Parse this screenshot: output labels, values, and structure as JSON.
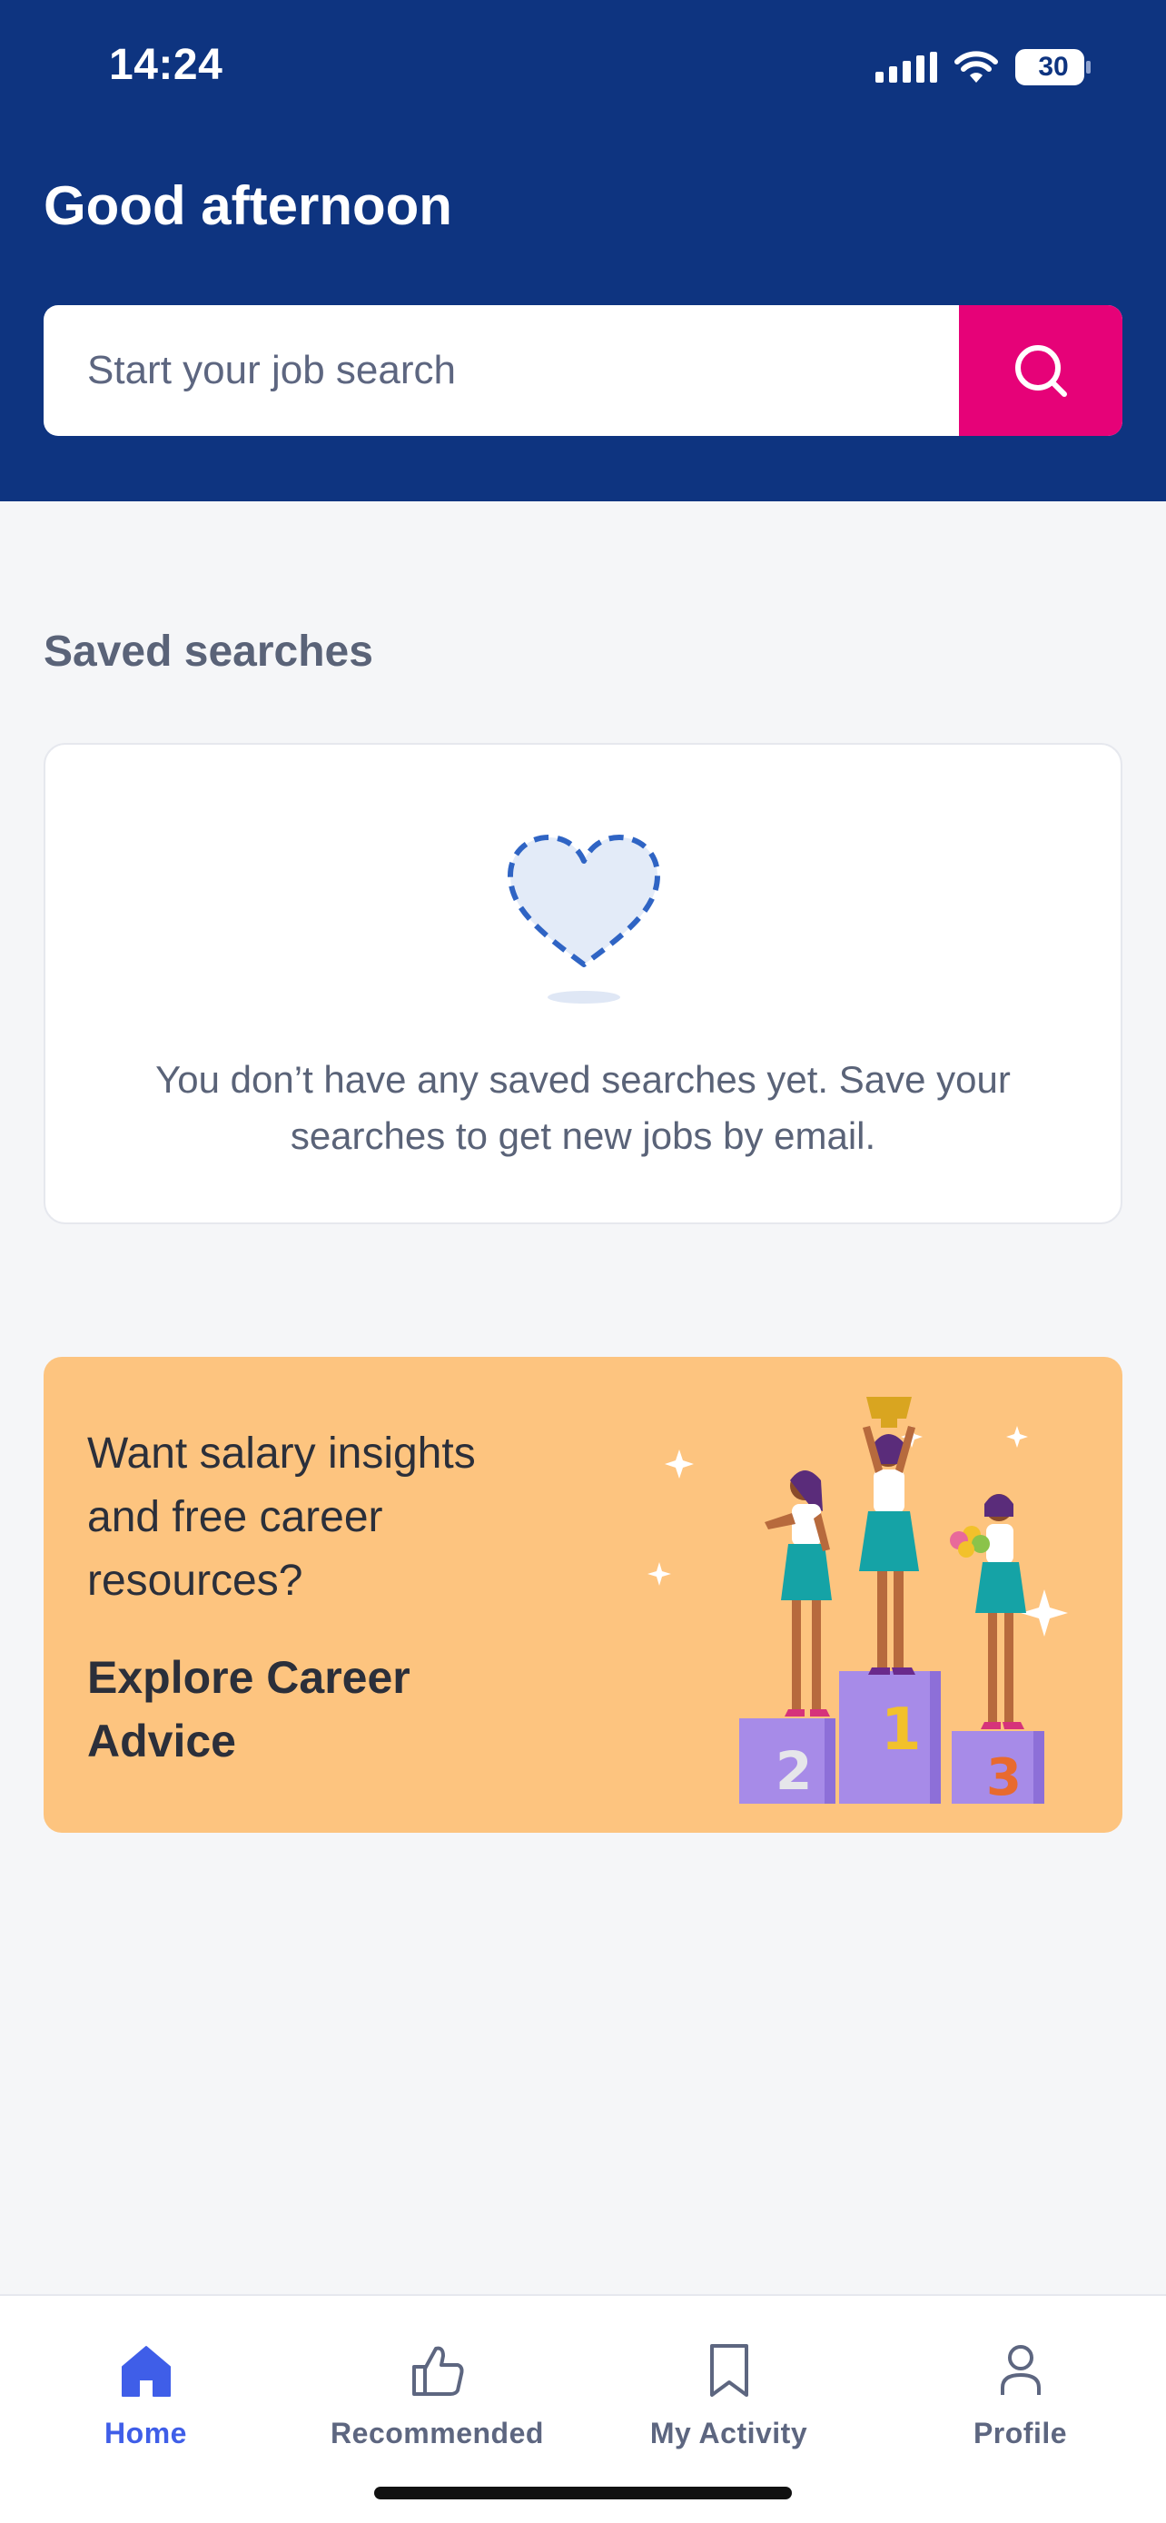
{
  "status_bar": {
    "time": "14:24",
    "battery_level": "30",
    "icons": [
      "signal-icon",
      "wifi-icon",
      "battery-icon"
    ]
  },
  "header": {
    "greeting": "Good afternoon",
    "background_color": "#0e3480"
  },
  "search": {
    "placeholder": "Start your job search",
    "button_icon": "search-icon",
    "button_color": "#e60278"
  },
  "saved_searches": {
    "title": "Saved searches",
    "illustration": "heart-icon",
    "empty_message": "You don’t have any saved searches yet. Save your searches to get new jobs by email."
  },
  "career_banner": {
    "text": "Want salary insights and free career resources?",
    "link_label": "Explore Career Advice",
    "background_color": "#fdc47f",
    "illustration": "podium-illustration",
    "podium_places": [
      "2",
      "1",
      "3"
    ]
  },
  "bottom_nav": {
    "active_color": "#3f5ee8",
    "items": [
      {
        "label": "Home",
        "icon": "home-icon",
        "active": true
      },
      {
        "label": "Recommended",
        "icon": "thumbs-up-icon",
        "active": false
      },
      {
        "label": "My Activity",
        "icon": "bookmark-icon",
        "active": false
      },
      {
        "label": "Profile",
        "icon": "person-icon",
        "active": false
      }
    ]
  }
}
